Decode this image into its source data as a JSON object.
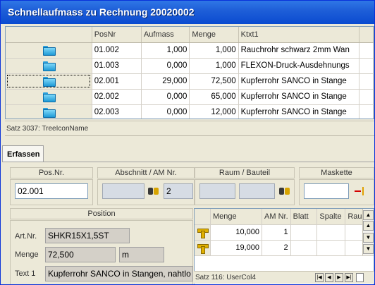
{
  "window": {
    "title": "Schnellaufmass zu Rechnung 20020002"
  },
  "grid": {
    "columns": [
      "",
      "PosNr",
      "Aufmass",
      "Menge",
      "Ktxt1"
    ],
    "rows": [
      {
        "posnr": "01.002",
        "aufmass": "1,000",
        "menge": "1,000",
        "ktxt1": "Rauchrohr schwarz 2mm Wan"
      },
      {
        "posnr": "01.003",
        "aufmass": "0,000",
        "menge": "1,000",
        "ktxt1": "FLEXON-Druck-Ausdehnungs"
      },
      {
        "posnr": "02.001",
        "aufmass": "29,000",
        "menge": "72,500",
        "ktxt1": "Kupferrohr  SANCO  in Stange"
      },
      {
        "posnr": "02.002",
        "aufmass": "0,000",
        "menge": "65,000",
        "ktxt1": "Kupferrohr  SANCO  in Stange"
      },
      {
        "posnr": "02.003",
        "aufmass": "0,000",
        "menge": "12,000",
        "ktxt1": "Kupferrohr  SANCO  in Stange"
      }
    ],
    "selected_row": 2,
    "row_icon": "folder-icon",
    "status": "Satz 3037: TreeIconName"
  },
  "tabs": {
    "erfassen": "Erfassen"
  },
  "form": {
    "posnr_label": "Pos.Nr.",
    "posnr_value": "02.001",
    "abschnitt_label": "Abschnitt / AM Nr.",
    "abschnitt_value": "",
    "am_value": "2",
    "raum_label": "Raum / Bauteil",
    "raum_value": "",
    "bauteil_value": "",
    "maskette_label": "Maskette",
    "maskette_value": "",
    "position_label": "Position",
    "artnr_label": "Art.Nr.",
    "artnr_value": "SHKR15X1,5ST",
    "menge_label": "Menge",
    "menge_value": "72,500",
    "einheit_value": "m",
    "text1_label": "Text 1",
    "text1_value": "Kupferrohr  SANCO  in Stangen, nahtlo"
  },
  "subgrid": {
    "columns": [
      "",
      "Menge",
      "AM Nr.",
      "Blatt",
      "Spalte",
      "Rau"
    ],
    "rows": [
      {
        "menge": "10,000",
        "amnr": "1"
      },
      {
        "menge": "19,000",
        "amnr": "2"
      }
    ],
    "row_icon": "tool-icon",
    "status": "Satz 116: UserCol4"
  },
  "colors": {
    "titlebar": "#0a4bd0",
    "field_readonly": "#d6dce4",
    "panel": "#ece9d8"
  }
}
